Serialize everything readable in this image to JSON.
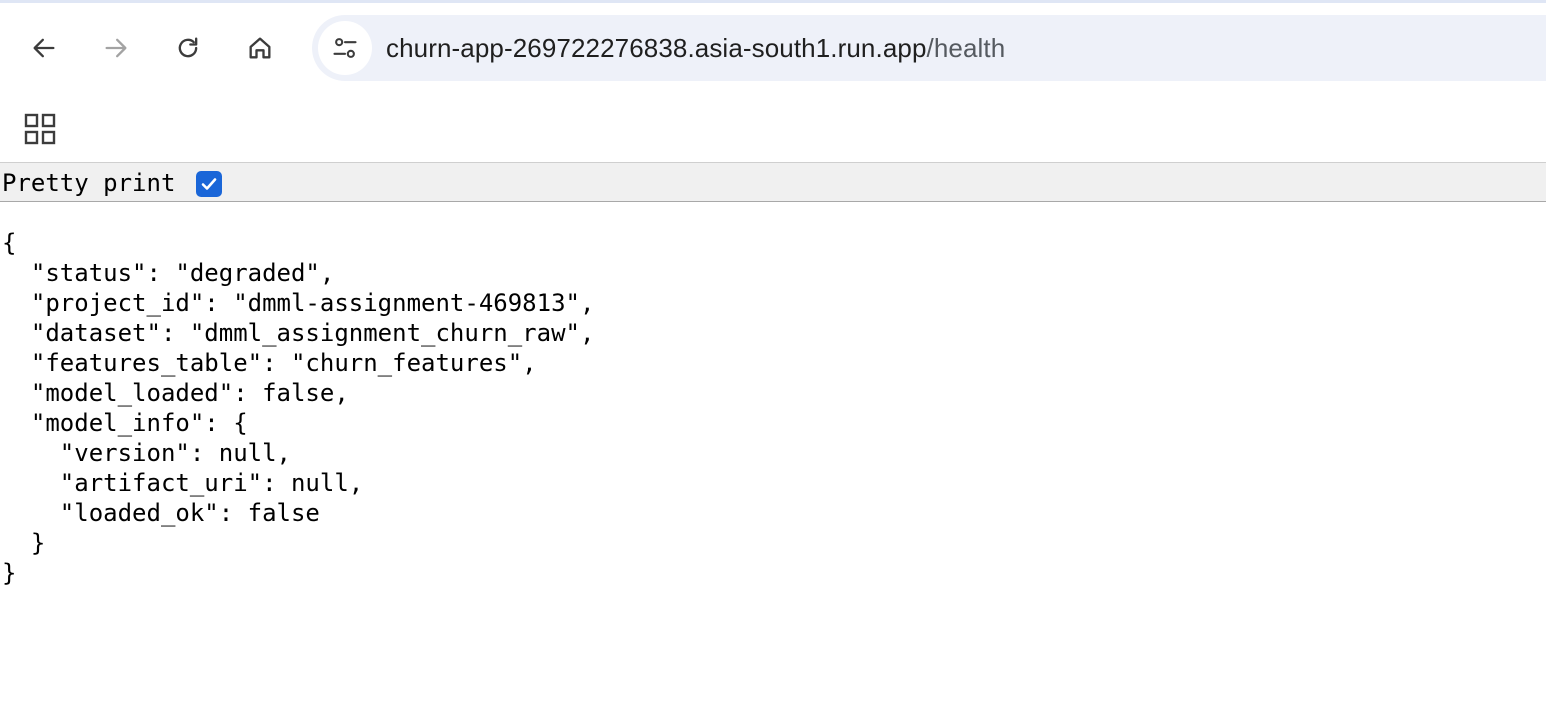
{
  "browser": {
    "url_host": "churn-app-269722276838.asia-south1.run.app",
    "url_path": "/health",
    "icons": {
      "back": "arrow-left-icon",
      "forward": "arrow-right-icon",
      "reload": "reload-icon",
      "home": "home-icon",
      "site_info": "tune-icon",
      "apps": "apps-grid-icon"
    }
  },
  "viewer": {
    "pretty_print_label": "Pretty print",
    "pretty_print_checked": true,
    "accent_color": "#1a66d8"
  },
  "json_lines": [
    "{",
    "  \"status\": \"degraded\",",
    "  \"project_id\": \"dmml-assignment-469813\",",
    "  \"dataset\": \"dmml_assignment_churn_raw\",",
    "  \"features_table\": \"churn_features\",",
    "  \"model_loaded\": false,",
    "  \"model_info\": {",
    "    \"version\": null,",
    "    \"artifact_uri\": null,",
    "    \"loaded_ok\": false",
    "  }",
    "}"
  ]
}
